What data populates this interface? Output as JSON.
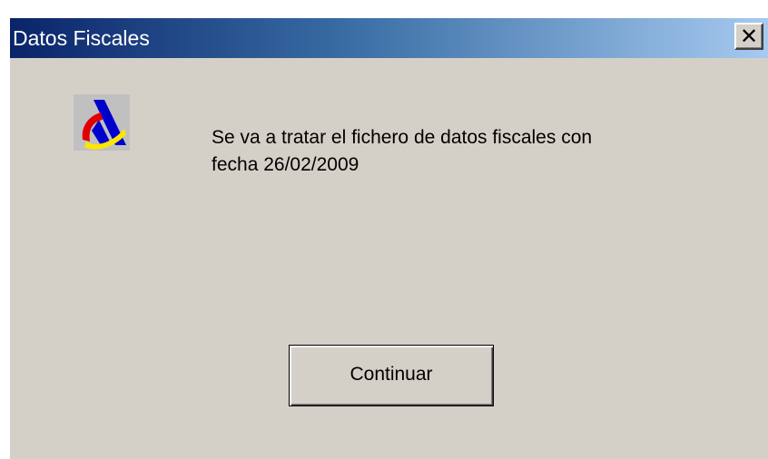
{
  "window": {
    "title": "Datos Fiscales",
    "close_label": "×"
  },
  "logo": {
    "icon": "aeat-logo-icon",
    "colors": {
      "blue": "#0000cc",
      "red": "#e00000",
      "yellow": "#ffe600"
    }
  },
  "message": {
    "line1": "Se va a tratar el fichero de datos fiscales con",
    "line2": "fecha 26/02/2009"
  },
  "buttons": {
    "continue_label": "Continuar"
  },
  "theme": {
    "face": "#d4d0c8",
    "title_start": "#0a246a",
    "title_end": "#a6caf0"
  }
}
